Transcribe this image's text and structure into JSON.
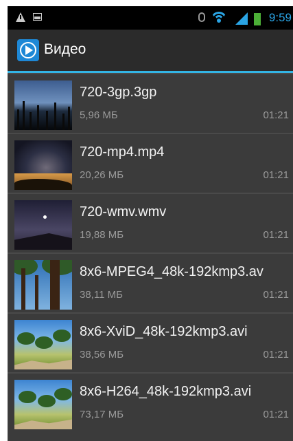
{
  "status_bar": {
    "time": "9:59",
    "icons": [
      "warning-icon",
      "image-notification-icon",
      "bluetooth-icon",
      "wifi-icon",
      "signal-icon",
      "battery-icon"
    ],
    "colors": {
      "accent": "#33b5e5",
      "battery": "#4caf37"
    }
  },
  "action_bar": {
    "title": "Видео",
    "icon": "video-player-icon"
  },
  "videos": [
    {
      "name": "720-3gp.3gp",
      "size": "5,96 МБ",
      "duration": "01:21"
    },
    {
      "name": "720-mp4.mp4",
      "size": "20,26 МБ",
      "duration": "01:21"
    },
    {
      "name": "720-wmv.wmv",
      "size": "19,88 МБ",
      "duration": "01:21"
    },
    {
      "name": "8x6-MPEG4_48k-192kmp3.av",
      "size": "38,11 МБ",
      "duration": "01:21"
    },
    {
      "name": "8x6-XviD_48k-192kmp3.avi",
      "size": "38,56 МБ",
      "duration": "01:21"
    },
    {
      "name": "8x6-H264_48k-192kmp3.avi",
      "size": "73,17 МБ",
      "duration": "01:21"
    }
  ]
}
